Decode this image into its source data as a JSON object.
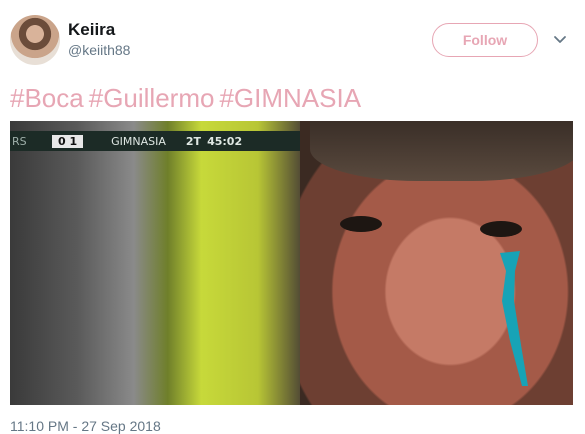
{
  "tweet": {
    "author": {
      "name": "Keiira",
      "handle": "@keiith88"
    },
    "follow_label": "Follow",
    "hashtags": [
      "#Boca",
      "#Guillermo",
      "#GIMNASIA"
    ],
    "timestamp": "11:10 PM - 27 Sep 2018"
  },
  "media": {
    "scoreboard": {
      "left_team": "RS",
      "score": "0 1",
      "right_team": "GIMNASIA",
      "period": "2T",
      "clock": "45:02"
    }
  },
  "colors": {
    "accent": "#e7a6b4",
    "name": "#14171a",
    "secondary": "#657786",
    "teardrop": "#17a3b6"
  },
  "icons": {
    "more": "chevron-down-icon"
  }
}
